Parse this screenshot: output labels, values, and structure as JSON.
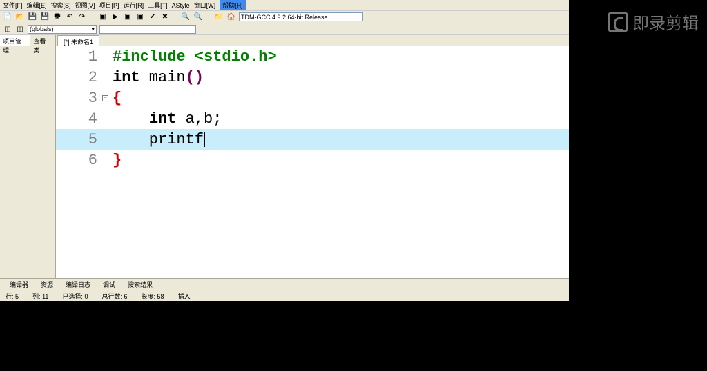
{
  "menubar": {
    "file": "文件[F]",
    "edit": "编辑[E]",
    "search": "搜索[S]",
    "view": "视图[V]",
    "project": "项目[P]",
    "run": "运行[R]",
    "tools": "工具[T]",
    "astyle": "AStyle",
    "window": "窗口[W]",
    "help": "帮助[H]"
  },
  "toolbar2": {
    "globals": "(globals)",
    "compiler": "TDM-GCC 4.9.2 64-bit Release"
  },
  "left_tabs": {
    "project": "项目管理",
    "view": "查看类"
  },
  "file_tab": "[*] 未命名1",
  "code": {
    "lines": [
      {
        "n": "1",
        "tokens": [
          {
            "t": "#include ",
            "c": "pre"
          },
          {
            "t": "<stdio.h>",
            "c": "inc-lt"
          }
        ]
      },
      {
        "n": "2",
        "tokens": [
          {
            "t": "int",
            "c": "kw"
          },
          {
            "t": " main",
            "c": "fn"
          },
          {
            "t": "()",
            "c": "paren"
          }
        ]
      },
      {
        "n": "3",
        "fold": true,
        "tokens": [
          {
            "t": "{",
            "c": "brace"
          }
        ]
      },
      {
        "n": "4",
        "tokens": [
          {
            "t": "    ",
            "c": "fn"
          },
          {
            "t": "int",
            "c": "kw"
          },
          {
            "t": " a,b;",
            "c": "fn"
          }
        ]
      },
      {
        "n": "5",
        "hl": true,
        "caret": true,
        "tokens": [
          {
            "t": "    printf",
            "c": "fn"
          }
        ]
      },
      {
        "n": "6",
        "tokens": [
          {
            "t": "}",
            "c": "brace"
          }
        ]
      }
    ]
  },
  "bottom_tabs": {
    "compiler": "编译器",
    "resource": "资源",
    "compile_log": "编译日志",
    "debug": "调试",
    "search_result": "搜索结果"
  },
  "status": {
    "line_label": "行:",
    "line": "5",
    "col_label": "列:",
    "col": "11",
    "sel_label": "已选择:",
    "sel": "0",
    "total_label": "总行数:",
    "total": "6",
    "len_label": "长度:",
    "len": "58",
    "mode": "插入"
  },
  "watermark": "即录剪辑"
}
